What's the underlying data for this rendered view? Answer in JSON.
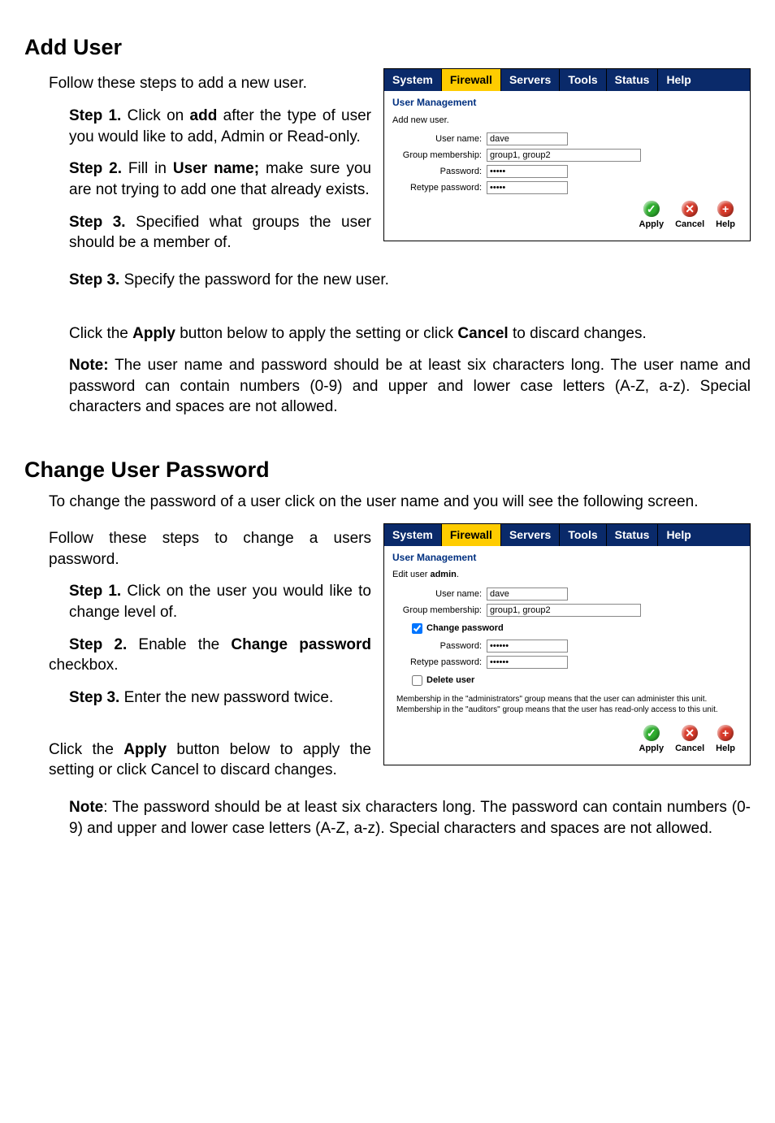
{
  "section1": {
    "heading": "Add User",
    "intro": "Follow these steps to add a new user.",
    "step1": {
      "label": "Step 1.",
      "text1": " Click on ",
      "bold": "add",
      "text2": " after the type of user you would like to add, Admin or Read-only."
    },
    "step2": {
      "label": "Step 2.",
      "text1": " Fill in ",
      "bold": "User name;",
      "text2": " make sure you are not trying to add one that already exists."
    },
    "step3a": {
      "label": "Step 3.",
      "text": " Specified what groups the user should be a member of."
    },
    "step3b": {
      "label": "Step 3.",
      "text": " Specify the password for the new user."
    },
    "apply_line": {
      "pre": "Click the ",
      "b1": "Apply",
      "mid": " button below to apply the setting or click ",
      "b2": "Cancel",
      "post": " to discard changes."
    },
    "note": {
      "label": "Note:",
      "text": " The user name and password should be at least six characters long. The user name and password can contain numbers (0-9) and upper and lower case letters (A-Z, a-z). Special characters and spaces are not allowed."
    }
  },
  "section2": {
    "heading": "Change User Password",
    "intro": "To change the password of a user click on the user name and you will see the following screen.",
    "follow": "Follow these steps to change a users password.",
    "step1": {
      "label": "Step 1.",
      "text": " Click on the user you would like to change level of."
    },
    "step2": {
      "label": "Step 2.",
      "text1": " Enable the ",
      "bold": "Change password",
      "text2": " checkbox."
    },
    "step3": {
      "label": "Step 3.",
      "text": " Enter the new password twice."
    },
    "apply_line": {
      "pre": "Click the ",
      "b1": "Apply",
      "mid": " button below to apply the setting or click Cancel to discard changes."
    },
    "note": {
      "label": "Note",
      "text": ": The password should be at least six characters long. The password can contain numbers (0-9) and upper and lower case letters (A-Z, a-z). Special characters and spaces are not allowed."
    }
  },
  "shot1": {
    "tabs": [
      "System",
      "Firewall",
      "Servers",
      "Tools",
      "Status",
      "Help"
    ],
    "title": "User Management",
    "sub": "Add new user.",
    "username_label": "User name:",
    "username_value": "dave",
    "group_label": "Group membership:",
    "group_value": "group1, group2",
    "password_label": "Password:",
    "password_value": "•••••",
    "retype_label": "Retype password:",
    "retype_value": "•••••",
    "btn_apply": "Apply",
    "btn_cancel": "Cancel",
    "btn_help": "Help"
  },
  "shot2": {
    "tabs": [
      "System",
      "Firewall",
      "Servers",
      "Tools",
      "Status",
      "Help"
    ],
    "title": "User Management",
    "sub_pre": "Edit user ",
    "sub_bold": "admin",
    "sub_post": ".",
    "username_label": "User name:",
    "username_value": "dave",
    "group_label": "Group membership:",
    "group_value": "group1, group2",
    "change_pw_label": "Change password",
    "password_label": "Password:",
    "password_value": "••••••",
    "retype_label": "Retype password:",
    "retype_value": "••••••",
    "delete_label": "Delete user",
    "note1": "Membership in the \"administrators\" group means that the user can administer this unit.",
    "note2": "Membership in the \"auditors\" group means that the user has read-only access to this unit.",
    "btn_apply": "Apply",
    "btn_cancel": "Cancel",
    "btn_help": "Help"
  }
}
